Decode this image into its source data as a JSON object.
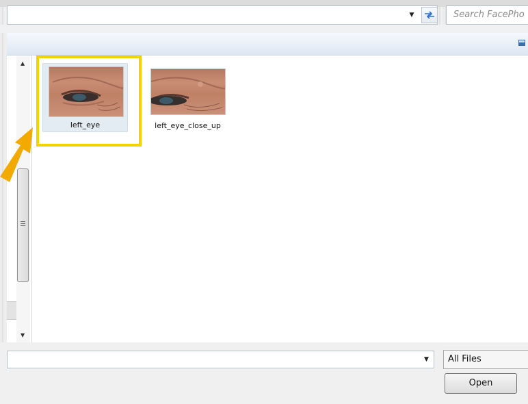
{
  "search": {
    "placeholder": "Search FacePho"
  },
  "files": [
    {
      "name": "left_eye"
    },
    {
      "name": "left_eye_close_up"
    }
  ],
  "file_type": {
    "selected": "All Files"
  },
  "buttons": {
    "open_label": "Open"
  },
  "colors": {
    "highlight": "#f2d200",
    "arrow": "#f2a900",
    "selection_bg": "#e3ebf3"
  },
  "icons": {
    "refresh": "refresh-icon",
    "dropdown": "chevron-down-icon",
    "arrow": "pointer-arrow"
  }
}
